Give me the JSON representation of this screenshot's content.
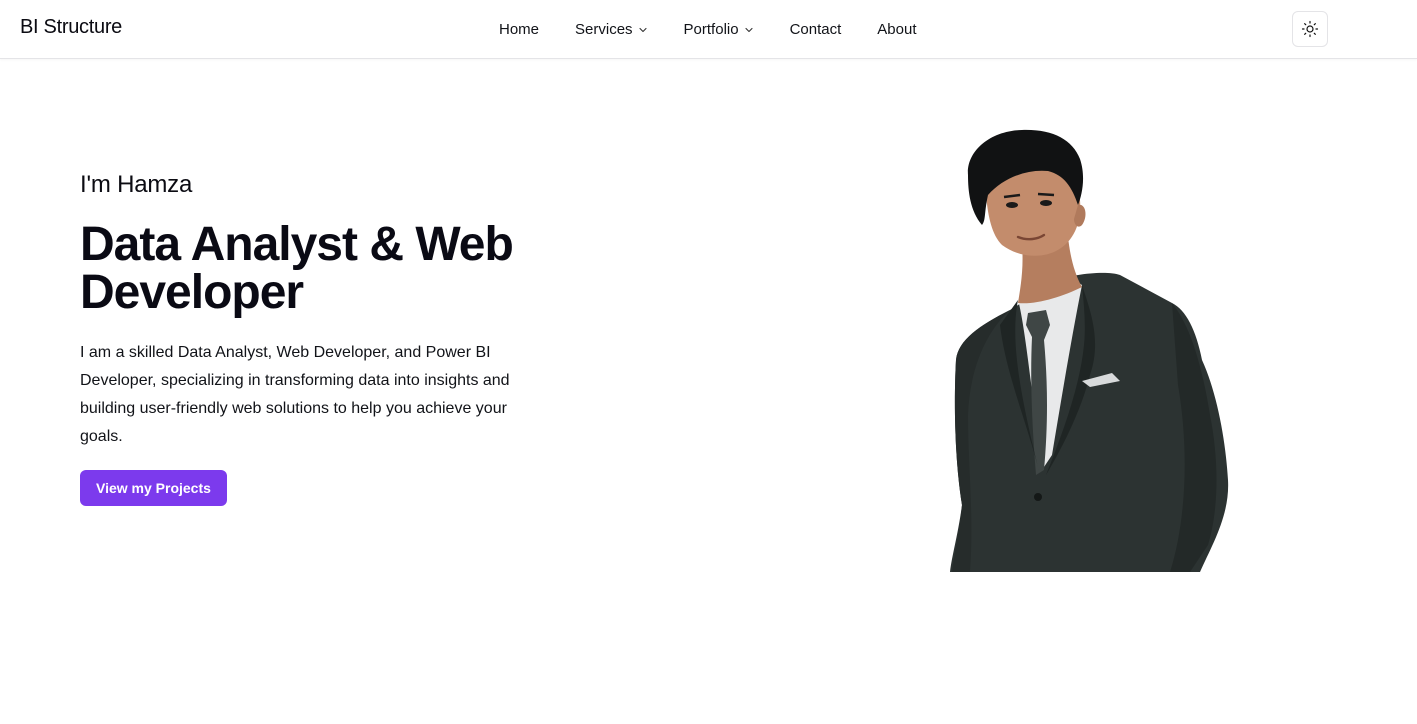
{
  "brand": {
    "name": "BI Structure"
  },
  "nav": {
    "items": [
      {
        "label": "Home",
        "dropdown": false
      },
      {
        "label": "Services",
        "dropdown": true
      },
      {
        "label": "Portfolio",
        "dropdown": true
      },
      {
        "label": "Contact",
        "dropdown": false
      },
      {
        "label": "About",
        "dropdown": false
      }
    ],
    "theme_toggle_icon": "sun-icon"
  },
  "hero": {
    "greeting": "I'm Hamza",
    "title": "Data Analyst & Web Developer",
    "description": "I am a skilled Data Analyst, Web Developer, and Power BI Developer, specializing in transforming data into insights and building user-friendly web solutions to help you achieve your goals.",
    "cta_label": "View my Projects",
    "portrait_icon": "portrait-photo"
  },
  "colors": {
    "accent": "#7c3aed",
    "text": "#0a0a14",
    "border": "#e4e4e7",
    "background": "#ffffff"
  }
}
